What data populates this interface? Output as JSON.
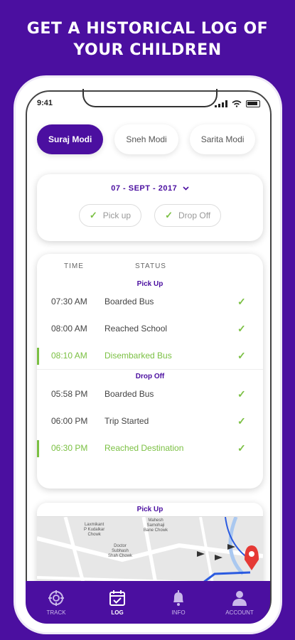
{
  "headline": {
    "line1": "GET A HISTORICAL LOG OF",
    "line2": "YOUR CHILDREN"
  },
  "status_bar": {
    "time": "9:41"
  },
  "tabs": [
    {
      "label": "Suraj Modi",
      "active": true
    },
    {
      "label": "Sneh Modi",
      "active": false
    },
    {
      "label": "Sarita Modi",
      "active": false
    }
  ],
  "date_selector": {
    "date": "07 - SEPT - 2017"
  },
  "filters": {
    "pickup": "Pick up",
    "dropoff": "Drop Off"
  },
  "log": {
    "headers": {
      "time": "TIME",
      "status": "STATUS"
    },
    "pickup_title": "Pick Up",
    "pickup_rows": [
      {
        "time": "07:30 AM",
        "status": "Boarded Bus"
      },
      {
        "time": "08:00 AM",
        "status": "Reached School"
      },
      {
        "time": "08:10 AM",
        "status": "Disembarked Bus"
      }
    ],
    "dropoff_title": "Drop Off",
    "dropoff_rows": [
      {
        "time": "05:58 PM",
        "status": "Boarded Bus"
      },
      {
        "time": "06:00 PM",
        "status": "Trip Started"
      },
      {
        "time": "06:30 PM",
        "status": "Reached Destination"
      }
    ]
  },
  "map": {
    "title": "Pick Up",
    "labels": {
      "l1": "Laxmikant",
      "l2": "P Kudalkar",
      "l3": "Chowk",
      "l4": "Mahesh",
      "l5": "Samohaji",
      "l6": "Bane Chowk",
      "l7": "Doctor",
      "l8": "Subhash",
      "l9": "Shah Chowk"
    }
  },
  "nav": [
    {
      "label": "TRACK",
      "icon": "target-icon",
      "active": false
    },
    {
      "label": "LOG",
      "icon": "calendar-check-icon",
      "active": true
    },
    {
      "label": "INFO",
      "icon": "bell-icon",
      "active": false
    },
    {
      "label": "ACCOUNT",
      "icon": "user-icon",
      "active": false
    }
  ],
  "colors": {
    "brand": "#4b0fa0",
    "success": "#7bc043"
  }
}
